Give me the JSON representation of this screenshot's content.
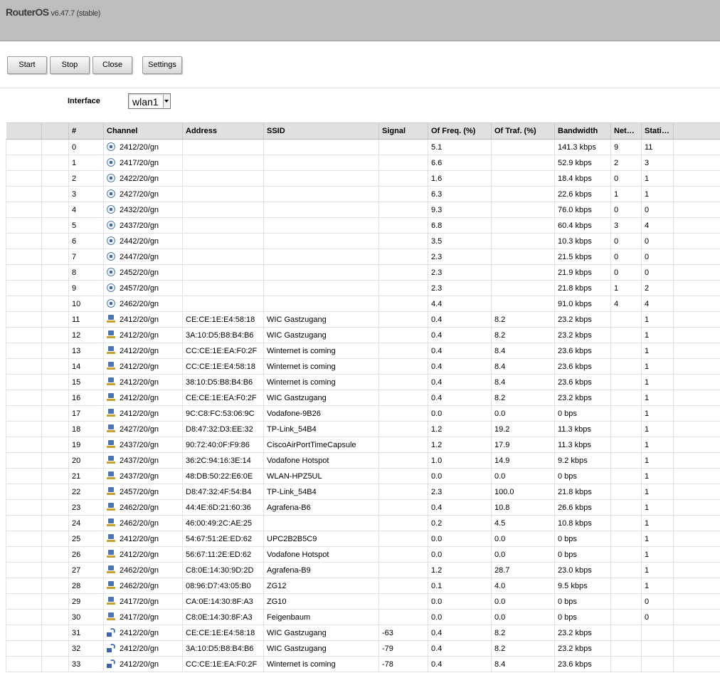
{
  "app": {
    "name": "RouterOS",
    "version": "v6.47.7 (stable)"
  },
  "toolbar": {
    "start": "Start",
    "stop": "Stop",
    "close": "Close",
    "settings": "Settings"
  },
  "interface": {
    "label": "Interface",
    "value": "wlan1"
  },
  "columns": [
    "",
    "",
    "#",
    "Channel",
    "Address",
    "SSID",
    "Signal",
    "Of Freq. (%)",
    "Of Traf. (%)",
    "Bandwidth",
    "Networks",
    "Stations",
    ""
  ],
  "rows": [
    {
      "n": "0",
      "icon": "channel",
      "channel": "2412/20/gn",
      "address": "",
      "ssid": "",
      "signal": "",
      "freq": "5.1",
      "traf": "",
      "bw": "141.3 kbps",
      "net": "9",
      "sta": "11"
    },
    {
      "n": "1",
      "icon": "channel",
      "channel": "2417/20/gn",
      "address": "",
      "ssid": "",
      "signal": "",
      "freq": "6.6",
      "traf": "",
      "bw": "52.9 kbps",
      "net": "2",
      "sta": "3"
    },
    {
      "n": "2",
      "icon": "channel",
      "channel": "2422/20/gn",
      "address": "",
      "ssid": "",
      "signal": "",
      "freq": "1.6",
      "traf": "",
      "bw": "18.4 kbps",
      "net": "0",
      "sta": "1"
    },
    {
      "n": "3",
      "icon": "channel",
      "channel": "2427/20/gn",
      "address": "",
      "ssid": "",
      "signal": "",
      "freq": "6.3",
      "traf": "",
      "bw": "22.6 kbps",
      "net": "1",
      "sta": "1"
    },
    {
      "n": "4",
      "icon": "channel",
      "channel": "2432/20/gn",
      "address": "",
      "ssid": "",
      "signal": "",
      "freq": "9.3",
      "traf": "",
      "bw": "76.0 kbps",
      "net": "0",
      "sta": "0"
    },
    {
      "n": "5",
      "icon": "channel",
      "channel": "2437/20/gn",
      "address": "",
      "ssid": "",
      "signal": "",
      "freq": "6.8",
      "traf": "",
      "bw": "60.4 kbps",
      "net": "3",
      "sta": "4"
    },
    {
      "n": "6",
      "icon": "channel",
      "channel": "2442/20/gn",
      "address": "",
      "ssid": "",
      "signal": "",
      "freq": "3.5",
      "traf": "",
      "bw": "10.3 kbps",
      "net": "0",
      "sta": "0"
    },
    {
      "n": "7",
      "icon": "channel",
      "channel": "2447/20/gn",
      "address": "",
      "ssid": "",
      "signal": "",
      "freq": "2.3",
      "traf": "",
      "bw": "21.5 kbps",
      "net": "0",
      "sta": "0"
    },
    {
      "n": "8",
      "icon": "channel",
      "channel": "2452/20/gn",
      "address": "",
      "ssid": "",
      "signal": "",
      "freq": "2.3",
      "traf": "",
      "bw": "21.9 kbps",
      "net": "0",
      "sta": "0"
    },
    {
      "n": "9",
      "icon": "channel",
      "channel": "2457/20/gn",
      "address": "",
      "ssid": "",
      "signal": "",
      "freq": "2.3",
      "traf": "",
      "bw": "21.8 kbps",
      "net": "1",
      "sta": "2"
    },
    {
      "n": "10",
      "icon": "channel",
      "channel": "2462/20/gn",
      "address": "",
      "ssid": "",
      "signal": "",
      "freq": "4.4",
      "traf": "",
      "bw": "91.0 kbps",
      "net": "4",
      "sta": "4"
    },
    {
      "n": "11",
      "icon": "ap",
      "channel": "2412/20/gn",
      "address": "CE:CE:1E:E4:58:18",
      "ssid": "WIC Gastzugang",
      "signal": "",
      "freq": "0.4",
      "traf": "8.2",
      "bw": "23.2 kbps",
      "net": "",
      "sta": "1"
    },
    {
      "n": "12",
      "icon": "ap",
      "channel": "2412/20/gn",
      "address": "3A:10:D5:B8:B4:B6",
      "ssid": "WIC Gastzugang",
      "signal": "",
      "freq": "0.4",
      "traf": "8.2",
      "bw": "23.2 kbps",
      "net": "",
      "sta": "1"
    },
    {
      "n": "13",
      "icon": "ap",
      "channel": "2412/20/gn",
      "address": "CC:CE:1E:EA:F0:2F",
      "ssid": "Winternet is coming",
      "signal": "",
      "freq": "0.4",
      "traf": "8.4",
      "bw": "23.6 kbps",
      "net": "",
      "sta": "1"
    },
    {
      "n": "14",
      "icon": "ap",
      "channel": "2412/20/gn",
      "address": "CC:CE:1E:E4:58:18",
      "ssid": "Winternet is coming",
      "signal": "",
      "freq": "0.4",
      "traf": "8.4",
      "bw": "23.6 kbps",
      "net": "",
      "sta": "1"
    },
    {
      "n": "15",
      "icon": "ap",
      "channel": "2412/20/gn",
      "address": "38:10:D5:B8:B4:B6",
      "ssid": "Winternet is coming",
      "signal": "",
      "freq": "0.4",
      "traf": "8.4",
      "bw": "23.6 kbps",
      "net": "",
      "sta": "1"
    },
    {
      "n": "16",
      "icon": "ap",
      "channel": "2412/20/gn",
      "address": "CE:CE:1E:EA:F0:2F",
      "ssid": "WIC Gastzugang",
      "signal": "",
      "freq": "0.4",
      "traf": "8.2",
      "bw": "23.2 kbps",
      "net": "",
      "sta": "1"
    },
    {
      "n": "17",
      "icon": "ap",
      "channel": "2412/20/gn",
      "address": "9C:C8:FC:53:06:9C",
      "ssid": "Vodafone-9B26",
      "signal": "",
      "freq": "0.0",
      "traf": "0.0",
      "bw": "0 bps",
      "net": "",
      "sta": "1"
    },
    {
      "n": "18",
      "icon": "ap",
      "channel": "2427/20/gn",
      "address": "D8:47:32:D3:EE:32",
      "ssid": "TP-Link_54B4",
      "signal": "",
      "freq": "1.2",
      "traf": "19.2",
      "bw": "11.3 kbps",
      "net": "",
      "sta": "1"
    },
    {
      "n": "19",
      "icon": "ap",
      "channel": "2437/20/gn",
      "address": "90:72:40:0F:F9:86",
      "ssid": "CiscoAirPortTimeCapsule",
      "signal": "",
      "freq": "1.2",
      "traf": "17.9",
      "bw": "11.3 kbps",
      "net": "",
      "sta": "1"
    },
    {
      "n": "20",
      "icon": "ap",
      "channel": "2437/20/gn",
      "address": "36:2C:94:16:3E:14",
      "ssid": "Vodafone Hotspot",
      "signal": "",
      "freq": "1.0",
      "traf": "14.9",
      "bw": "9.2 kbps",
      "net": "",
      "sta": "1"
    },
    {
      "n": "21",
      "icon": "ap",
      "channel": "2437/20/gn",
      "address": "48:DB:50:22:E6:0E",
      "ssid": "WLAN-HPZ5UL",
      "signal": "",
      "freq": "0.0",
      "traf": "0.0",
      "bw": "0 bps",
      "net": "",
      "sta": "1"
    },
    {
      "n": "22",
      "icon": "ap",
      "channel": "2457/20/gn",
      "address": "D8:47:32:4F:54:B4",
      "ssid": "TP-Link_54B4",
      "signal": "",
      "freq": "2.3",
      "traf": "100.0",
      "bw": "21.8 kbps",
      "net": "",
      "sta": "1"
    },
    {
      "n": "23",
      "icon": "ap",
      "channel": "2462/20/gn",
      "address": "44:4E:6D:21:60:36",
      "ssid": "Agrafena-B6",
      "signal": "",
      "freq": "0.4",
      "traf": "10.8",
      "bw": "26.6 kbps",
      "net": "",
      "sta": "1"
    },
    {
      "n": "24",
      "icon": "ap",
      "channel": "2462/20/gn",
      "address": "46:00:49:2C:AE:25",
      "ssid": "",
      "signal": "",
      "freq": "0.2",
      "traf": "4.5",
      "bw": "10.8 kbps",
      "net": "",
      "sta": "1"
    },
    {
      "n": "25",
      "icon": "ap",
      "channel": "2412/20/gn",
      "address": "54:67:51:2E:ED:62",
      "ssid": "UPC2B2B5C9",
      "signal": "",
      "freq": "0.0",
      "traf": "0.0",
      "bw": "0 bps",
      "net": "",
      "sta": "1"
    },
    {
      "n": "26",
      "icon": "ap",
      "channel": "2412/20/gn",
      "address": "56:67:11:2E:ED:62",
      "ssid": "Vodafone Hotspot",
      "signal": "",
      "freq": "0.0",
      "traf": "0.0",
      "bw": "0 bps",
      "net": "",
      "sta": "1"
    },
    {
      "n": "27",
      "icon": "ap",
      "channel": "2462/20/gn",
      "address": "C8:0E:14:30:9D:2D",
      "ssid": "Agrafena-B9",
      "signal": "",
      "freq": "1.2",
      "traf": "28.7",
      "bw": "23.0 kbps",
      "net": "",
      "sta": "1"
    },
    {
      "n": "28",
      "icon": "ap",
      "channel": "2462/20/gn",
      "address": "08:96:D7:43:05:B0",
      "ssid": "ZG12",
      "signal": "",
      "freq": "0.1",
      "traf": "4.0",
      "bw": "9.5 kbps",
      "net": "",
      "sta": "1"
    },
    {
      "n": "29",
      "icon": "ap",
      "channel": "2417/20/gn",
      "address": "CA:0E:14:30:8F:A3",
      "ssid": "ZG10",
      "signal": "",
      "freq": "0.0",
      "traf": "0.0",
      "bw": "0 bps",
      "net": "",
      "sta": "0"
    },
    {
      "n": "30",
      "icon": "ap",
      "channel": "2417/20/gn",
      "address": "C8:0E:14:30:8F:A3",
      "ssid": "Feigenbaum",
      "signal": "",
      "freq": "0.0",
      "traf": "0.0",
      "bw": "0 bps",
      "net": "",
      "sta": "0"
    },
    {
      "n": "31",
      "icon": "client",
      "channel": "2412/20/gn",
      "address": "CE:CE:1E:E4:58:18",
      "ssid": "WIC Gastzugang",
      "signal": "-63",
      "freq": "0.4",
      "traf": "8.2",
      "bw": "23.2 kbps",
      "net": "",
      "sta": ""
    },
    {
      "n": "32",
      "icon": "client",
      "channel": "2412/20/gn",
      "address": "3A:10:D5:B8:B4:B6",
      "ssid": "WIC Gastzugang",
      "signal": "-79",
      "freq": "0.4",
      "traf": "8.2",
      "bw": "23.2 kbps",
      "net": "",
      "sta": ""
    },
    {
      "n": "33",
      "icon": "client",
      "channel": "2412/20/gn",
      "address": "CC:CE:1E:EA:F0:2F",
      "ssid": "Winternet is coming",
      "signal": "-78",
      "freq": "0.4",
      "traf": "8.4",
      "bw": "23.6 kbps",
      "net": "",
      "sta": ""
    }
  ]
}
